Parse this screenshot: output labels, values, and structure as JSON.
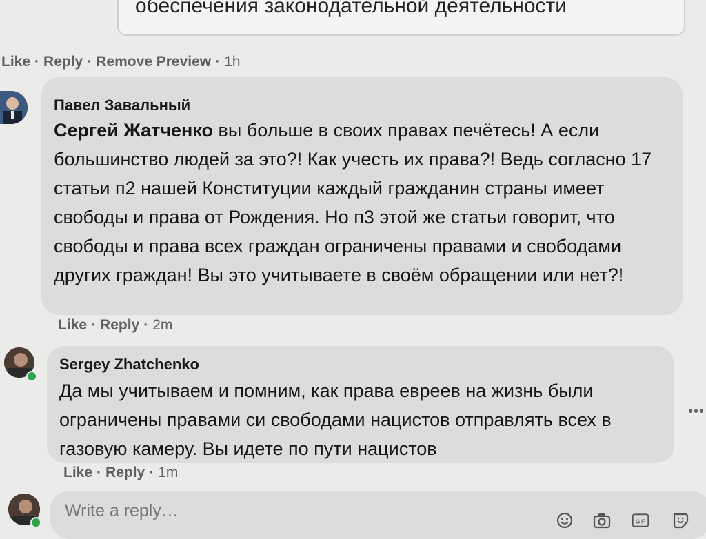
{
  "top_preview": {
    "text": "обеспечения законодательной деятельности"
  },
  "top_actions": {
    "like": "Like",
    "reply": "Reply",
    "remove_preview": "Remove Preview",
    "time": "1h"
  },
  "comments": [
    {
      "author": "Павел Завальный",
      "mention": "Сергей Жатченко",
      "text": " вы больше в своих правах печётесь! А если большинство людей за это?! Как учесть их права?! Ведь согласно 17 статьи п2 нашей Конституции каждый гражданин страны имеет свободы и права от Рождения. Но п3 этой же статьи говорит, что свободы и права всех граждан ограничены правами и свободами других граждан! Вы это учитываете в своём обращении или нет?!",
      "like": "Like",
      "reply": "Reply",
      "time": "2m"
    },
    {
      "author": "Sergey Zhatchenko",
      "text": "Да мы учитываем и помним, как права евреев на жизнь были ограничены правами си свободами нацистов отправлять всех в газовую камеру. Вы идете по пути нацистов",
      "like": "Like",
      "reply": "Reply",
      "time": "1m"
    }
  ],
  "reply_box": {
    "placeholder": "Write a reply…"
  },
  "icons": [
    "emoji-icon",
    "camera-icon",
    "gif-icon",
    "sticker-icon",
    "more-icon"
  ]
}
